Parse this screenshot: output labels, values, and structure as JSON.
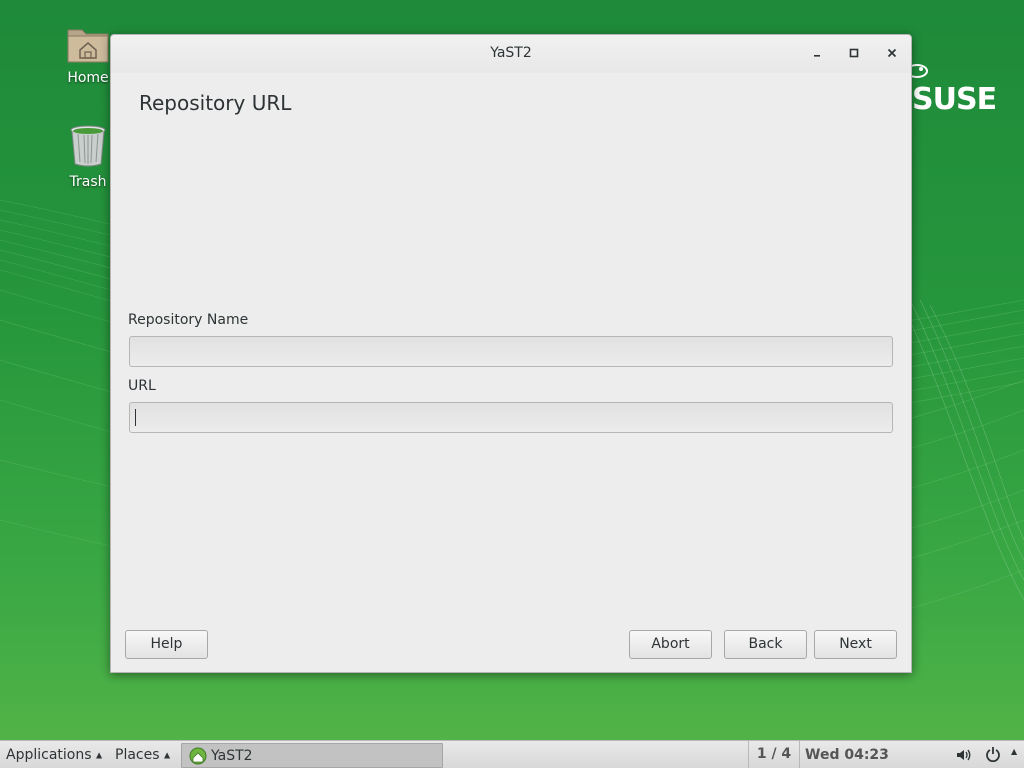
{
  "desktop": {
    "brand": "SUSE",
    "icons": [
      {
        "label": "Home"
      },
      {
        "label": "Trash"
      }
    ]
  },
  "window": {
    "title": "YaST2",
    "controls": {
      "minimize": "–",
      "maximize": "□",
      "close": "×"
    },
    "page_title": "Repository URL",
    "fields": {
      "name_label": "Repository Name",
      "name_value": "",
      "url_label": "URL",
      "url_value": ""
    },
    "buttons": {
      "help": "Help",
      "abort": "Abort",
      "back": "Back",
      "next": "Next"
    }
  },
  "taskbar": {
    "applications": "Applications",
    "places": "Places",
    "task_label": "YaST2",
    "workspace": "1 / 4",
    "clock": "Wed 04:23"
  },
  "colors": {
    "desktop_green": "#26963c",
    "window_bg": "#ededed",
    "taskbar_bg": "#e0e0e0"
  }
}
